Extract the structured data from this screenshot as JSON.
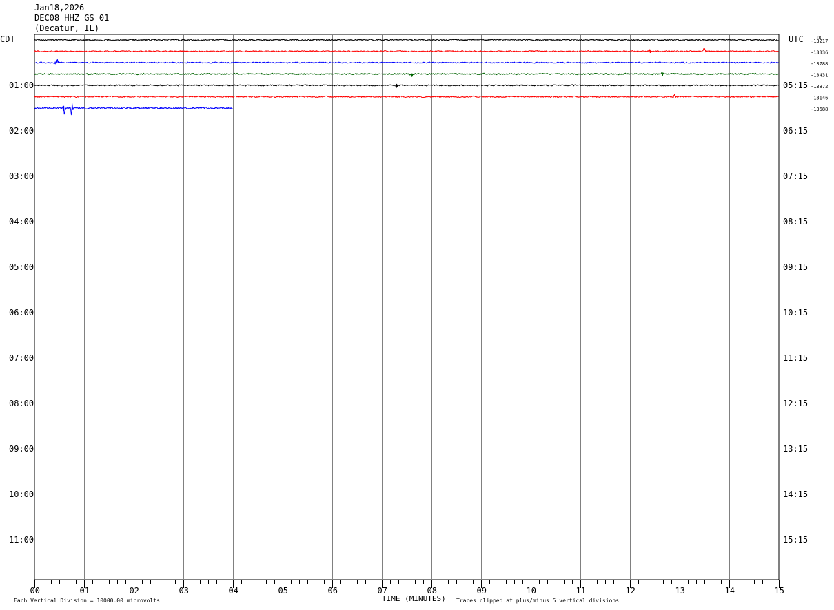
{
  "header": {
    "date": "Jan18,2026",
    "station": "DEC08 HHZ GS 01",
    "location": "(Decatur, IL)"
  },
  "left_tz": "CDT",
  "right_tz": "UTC",
  "dc_label": "DC",
  "footer": {
    "scale_note": "Each Vertical Division = 10000.00 microvolts",
    "xlabel": "TIME (MINUTES)",
    "clip_note": "Traces clipped at plus/minus 5 vertical divisions"
  },
  "colors": {
    "black": "#000000",
    "red": "#ff0000",
    "blue": "#0000ff",
    "green": "#006400",
    "grid": "#808080"
  },
  "chart_data": {
    "type": "line",
    "title": "",
    "xlabel": "TIME (MINUTES)",
    "ylabel": "",
    "xlim": [
      0,
      15
    ],
    "x_ticks": [
      "00",
      "01",
      "02",
      "03",
      "04",
      "05",
      "06",
      "07",
      "08",
      "09",
      "10",
      "11",
      "12",
      "13",
      "14",
      "15"
    ],
    "minor_ticks_per_minute": 6,
    "rows_visible": 48,
    "left_hour_labels": [
      {
        "row": 4,
        "label": "01:00"
      },
      {
        "row": 8,
        "label": "02:00"
      },
      {
        "row": 12,
        "label": "03:00"
      },
      {
        "row": 16,
        "label": "04:00"
      },
      {
        "row": 20,
        "label": "05:00"
      },
      {
        "row": 24,
        "label": "06:00"
      },
      {
        "row": 28,
        "label": "07:00"
      },
      {
        "row": 32,
        "label": "08:00"
      },
      {
        "row": 36,
        "label": "09:00"
      },
      {
        "row": 40,
        "label": "10:00"
      },
      {
        "row": 44,
        "label": "11:00"
      }
    ],
    "right_hour_labels": [
      {
        "row": 4,
        "label": "05:15"
      },
      {
        "row": 8,
        "label": "06:15"
      },
      {
        "row": 12,
        "label": "07:15"
      },
      {
        "row": 16,
        "label": "08:15"
      },
      {
        "row": 20,
        "label": "09:15"
      },
      {
        "row": 24,
        "label": "10:15"
      },
      {
        "row": 28,
        "label": "11:15"
      },
      {
        "row": 32,
        "label": "12:15"
      },
      {
        "row": 36,
        "label": "13:15"
      },
      {
        "row": 40,
        "label": "14:15"
      },
      {
        "row": 44,
        "label": "15:15"
      }
    ],
    "series": [
      {
        "row": 0,
        "color": "black",
        "end_min": 15,
        "dc": "-13217",
        "noise": 1.4,
        "events": [
          {
            "t": 3.0,
            "amp": 3
          }
        ]
      },
      {
        "row": 1,
        "color": "red",
        "end_min": 15,
        "dc": "-13336",
        "noise": 1.2,
        "events": [
          {
            "t": 12.4,
            "amp": 5
          },
          {
            "t": 13.5,
            "amp": 11
          }
        ]
      },
      {
        "row": 2,
        "color": "blue",
        "end_min": 15,
        "dc": "-13788",
        "noise": 1.2,
        "events": [
          {
            "t": 0.45,
            "amp": 10
          }
        ]
      },
      {
        "row": 3,
        "color": "green",
        "end_min": 15,
        "dc": "-13431",
        "noise": 1.4,
        "events": [
          {
            "t": 7.6,
            "amp": 8
          },
          {
            "t": 12.65,
            "amp": 6
          }
        ]
      },
      {
        "row": 4,
        "color": "black",
        "end_min": 15,
        "dc": "-13872",
        "noise": 1.3,
        "events": [
          {
            "t": 7.3,
            "amp": 6
          }
        ]
      },
      {
        "row": 5,
        "color": "red",
        "end_min": 15,
        "dc": "-13146",
        "noise": 1.4,
        "events": [
          {
            "t": 12.9,
            "amp": 5
          }
        ]
      },
      {
        "row": 6,
        "color": "blue",
        "end_min": 4.0,
        "dc": "-13688",
        "noise": 1.8,
        "events": [
          {
            "t": 0.6,
            "amp": 14
          },
          {
            "t": 0.75,
            "amp": 18
          }
        ]
      }
    ]
  }
}
